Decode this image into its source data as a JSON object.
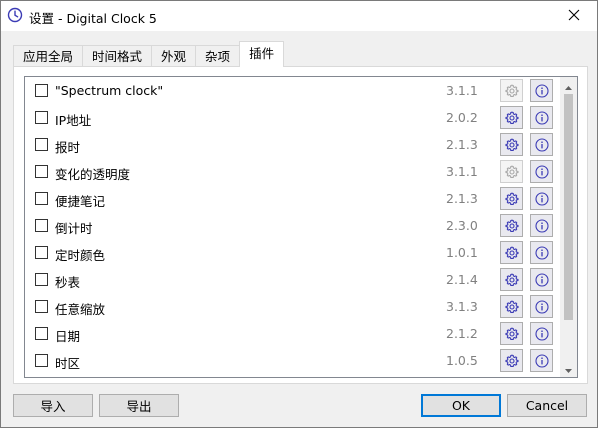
{
  "window": {
    "title": "设置 - Digital Clock 5"
  },
  "tabs": [
    {
      "label": "应用全局"
    },
    {
      "label": "时间格式"
    },
    {
      "label": "外观"
    },
    {
      "label": "杂项"
    },
    {
      "label": "插件"
    }
  ],
  "active_tab": "插件",
  "plugins": [
    {
      "name": "\"Spectrum clock\"",
      "version": "3.1.1",
      "checked": false,
      "configurable": false
    },
    {
      "name": "IP地址",
      "version": "2.0.2",
      "checked": false,
      "configurable": true
    },
    {
      "name": "报时",
      "version": "2.1.3",
      "checked": false,
      "configurable": true
    },
    {
      "name": "变化的透明度",
      "version": "3.1.1",
      "checked": false,
      "configurable": false
    },
    {
      "name": "便捷笔记",
      "version": "2.1.3",
      "checked": false,
      "configurable": true
    },
    {
      "name": "倒计时",
      "version": "2.3.0",
      "checked": false,
      "configurable": true
    },
    {
      "name": "定时颜色",
      "version": "1.0.1",
      "checked": false,
      "configurable": true
    },
    {
      "name": "秒表",
      "version": "2.1.4",
      "checked": false,
      "configurable": true
    },
    {
      "name": "任意缩放",
      "version": "3.1.3",
      "checked": false,
      "configurable": true
    },
    {
      "name": "日期",
      "version": "2.1.2",
      "checked": false,
      "configurable": true
    },
    {
      "name": "时区",
      "version": "1.0.5",
      "checked": false,
      "configurable": true
    }
  ],
  "buttons": {
    "import": "导入",
    "export": "导出",
    "ok": "OK",
    "cancel": "Cancel"
  },
  "colors": {
    "accent": "#0078d7",
    "icon_active": "#3b3bb5",
    "icon_disabled": "#a8a8a8"
  }
}
